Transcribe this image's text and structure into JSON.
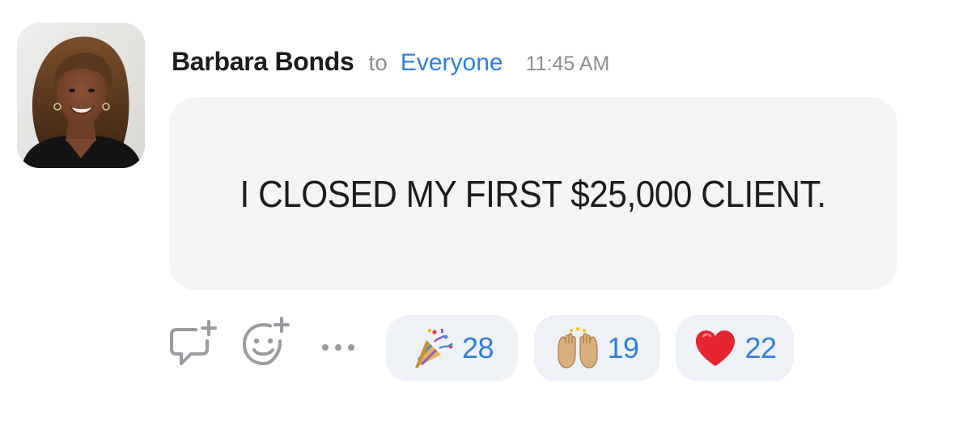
{
  "message": {
    "sender": "Barbara Bonds",
    "to_label": "to",
    "recipient": "Everyone",
    "time": "11:45 AM",
    "text": "I CLOSED MY FIRST $25,000 CLIENT."
  },
  "actions": [
    {
      "icon": "reply-plus-icon"
    },
    {
      "icon": "add-reaction-icon"
    },
    {
      "icon": "more-options-icon"
    }
  ],
  "reactions": [
    {
      "emoji": "party-popper",
      "count": "28"
    },
    {
      "emoji": "raising-hands",
      "count": "19"
    },
    {
      "emoji": "red-heart",
      "count": "22"
    }
  ],
  "colors": {
    "accent": "#2f7fe0",
    "bubble": "#f4f4f7",
    "reaction_pill": "#eef1f6",
    "muted": "#8e8e93",
    "text": "#1c1c1e"
  }
}
